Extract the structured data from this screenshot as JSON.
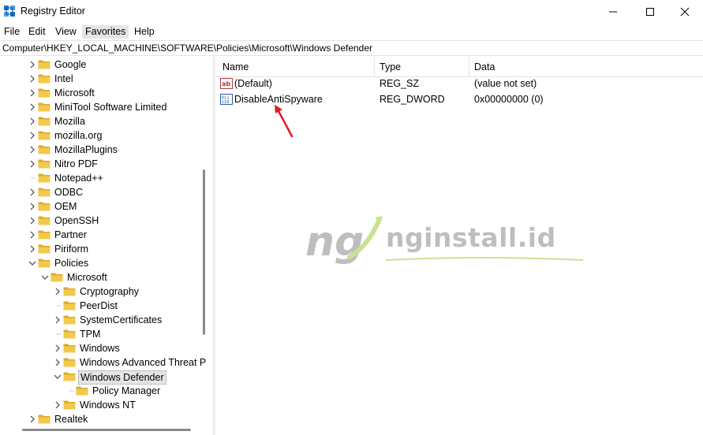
{
  "window": {
    "title": "Registry Editor",
    "icon": "registry-editor-icon"
  },
  "menu": {
    "items": [
      "File",
      "Edit",
      "View",
      "Favorites",
      "Help"
    ],
    "active": "Favorites"
  },
  "address": {
    "path": "Computer\\HKEY_LOCAL_MACHINE\\SOFTWARE\\Policies\\Microsoft\\Windows Defender"
  },
  "tree": {
    "items": [
      {
        "label": "Google",
        "depth": 0,
        "expander": "collapsed"
      },
      {
        "label": "Intel",
        "depth": 0,
        "expander": "collapsed"
      },
      {
        "label": "Microsoft",
        "depth": 0,
        "expander": "collapsed"
      },
      {
        "label": "MiniTool Software Limited",
        "depth": 0,
        "expander": "collapsed"
      },
      {
        "label": "Mozilla",
        "depth": 0,
        "expander": "collapsed"
      },
      {
        "label": "mozilla.org",
        "depth": 0,
        "expander": "collapsed"
      },
      {
        "label": "MozillaPlugins",
        "depth": 0,
        "expander": "collapsed"
      },
      {
        "label": "Nitro PDF",
        "depth": 0,
        "expander": "collapsed"
      },
      {
        "label": "Notepad++",
        "depth": 0,
        "expander": "none"
      },
      {
        "label": "ODBC",
        "depth": 0,
        "expander": "collapsed"
      },
      {
        "label": "OEM",
        "depth": 0,
        "expander": "collapsed"
      },
      {
        "label": "OpenSSH",
        "depth": 0,
        "expander": "collapsed"
      },
      {
        "label": "Partner",
        "depth": 0,
        "expander": "collapsed"
      },
      {
        "label": "Piriform",
        "depth": 0,
        "expander": "collapsed"
      },
      {
        "label": "Policies",
        "depth": 0,
        "expander": "expanded"
      },
      {
        "label": "Microsoft",
        "depth": 1,
        "expander": "expanded"
      },
      {
        "label": "Cryptography",
        "depth": 2,
        "expander": "collapsed"
      },
      {
        "label": "PeerDist",
        "depth": 2,
        "expander": "none"
      },
      {
        "label": "SystemCertificates",
        "depth": 2,
        "expander": "collapsed"
      },
      {
        "label": "TPM",
        "depth": 2,
        "expander": "none"
      },
      {
        "label": "Windows",
        "depth": 2,
        "expander": "collapsed"
      },
      {
        "label": "Windows Advanced Threat P",
        "depth": 2,
        "expander": "collapsed"
      },
      {
        "label": "Windows Defender",
        "depth": 2,
        "expander": "expanded",
        "selected": true
      },
      {
        "label": "Policy Manager",
        "depth": 3,
        "expander": "none"
      },
      {
        "label": "Windows NT",
        "depth": 2,
        "expander": "collapsed"
      },
      {
        "label": "Realtek",
        "depth": 0,
        "expander": "collapsed"
      }
    ]
  },
  "list": {
    "columns": [
      "Name",
      "Type",
      "Data"
    ],
    "rows": [
      {
        "icon": "string-value-icon",
        "name": "(Default)",
        "type": "REG_SZ",
        "data": "(value not set)"
      },
      {
        "icon": "dword-value-icon",
        "name": "DisableAntiSpyware",
        "type": "REG_DWORD",
        "data": "0x00000000 (0)"
      }
    ]
  },
  "annotation": {
    "icon": "red-arrow-icon",
    "color": "#e11b22"
  },
  "watermark": {
    "text": "nginstall.id",
    "logo": "ng"
  },
  "colors": {
    "folder": "#f2c94c",
    "folder_dark": "#e0a82e",
    "selection": "#e5e5e5",
    "watermark_gray": "#8a8a8a",
    "watermark_green": "#9ccc3c"
  }
}
